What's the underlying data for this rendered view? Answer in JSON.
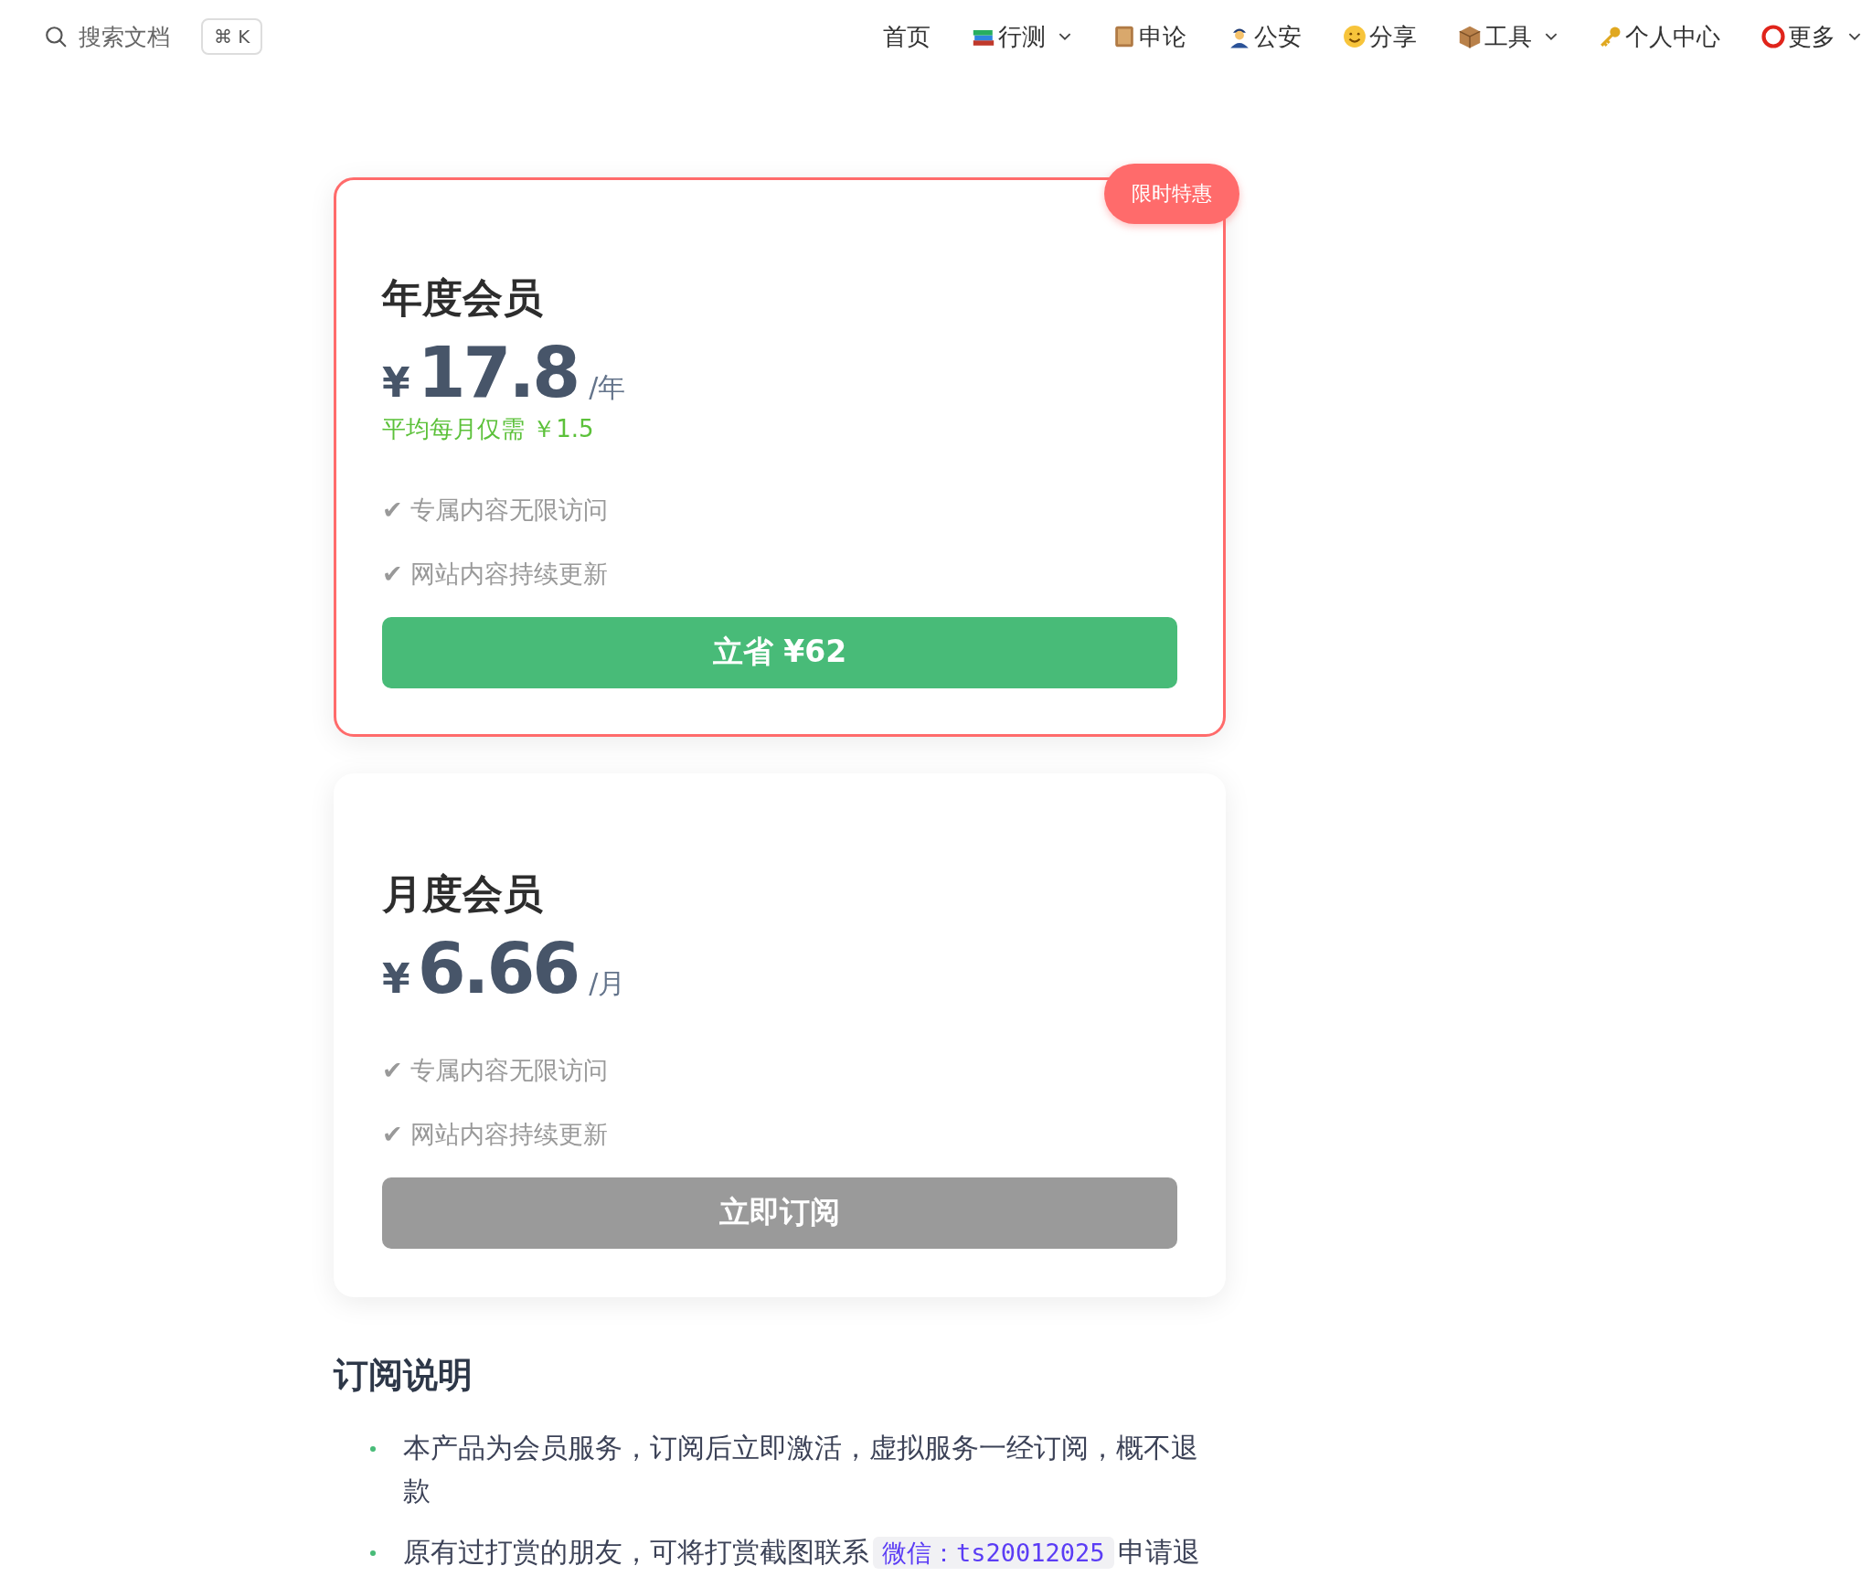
{
  "search": {
    "placeholder": "搜索文档",
    "shortcut": "⌘ K"
  },
  "nav": [
    {
      "label": "首页",
      "has_dropdown": false
    },
    {
      "label": "行测",
      "has_dropdown": true
    },
    {
      "label": "申论",
      "has_dropdown": false
    },
    {
      "label": "公安",
      "has_dropdown": false
    },
    {
      "label": "分享",
      "has_dropdown": false
    },
    {
      "label": "工具",
      "has_dropdown": true
    },
    {
      "label": "个人中心",
      "has_dropdown": false
    },
    {
      "label": "更多",
      "has_dropdown": true
    }
  ],
  "plans": [
    {
      "featured": true,
      "badge": "限时特惠",
      "title": "年度会员",
      "currency": "¥",
      "price": "17.8",
      "period": "/年",
      "note": "平均每月仅需 ￥1.5",
      "features": [
        "✔ 专属内容无限访问",
        "✔ 网站内容持续更新"
      ],
      "button": {
        "label": "立省 ¥62",
        "kind": "primary"
      }
    },
    {
      "featured": false,
      "title": "月度会员",
      "currency": "¥",
      "price": "6.66",
      "period": "/月",
      "features": [
        "✔ 专属内容无限访问",
        "✔ 网站内容持续更新"
      ],
      "button": {
        "label": "立即订阅",
        "kind": "muted"
      }
    }
  ],
  "notes": {
    "heading": "订阅说明",
    "items": [
      {
        "text": "本产品为会员服务，订阅后立即激活，虚拟服务一经订阅，概不退款"
      },
      {
        "text": "原有过打赏的朋友，可将打赏截图联系",
        "code": "微信：ts20012025",
        "after": "申请退"
      }
    ]
  }
}
